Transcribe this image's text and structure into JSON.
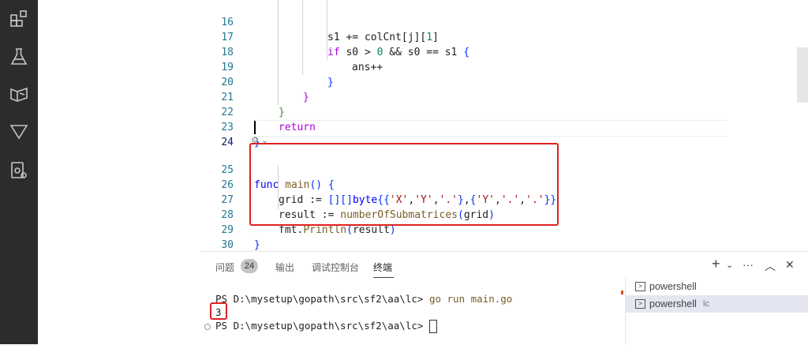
{
  "activity_bar": {
    "icons": [
      "extensions-icon",
      "flask-icon",
      "remote-icon",
      "source-control-icon",
      "run-debug-icon"
    ]
  },
  "editor": {
    "lines": [
      {
        "n": "16",
        "t": "s1 += colCnt[j][1]"
      },
      {
        "n": "17",
        "t": "if s0 > 0 && s0 == s1 {"
      },
      {
        "n": "18",
        "t": "ans++"
      },
      {
        "n": "19",
        "t": "}"
      },
      {
        "n": "20",
        "t": "}"
      },
      {
        "n": "21",
        "t": "}"
      },
      {
        "n": "22",
        "t": "return"
      },
      {
        "n": "23",
        "t": "}"
      },
      {
        "n": "24",
        "t": ""
      },
      {
        "n": "25",
        "t": "func main() {"
      },
      {
        "n": "26",
        "t": "grid := [][]byte{{'X','Y','.'},{'Y','.','.'}}"
      },
      {
        "n": "27",
        "t": "result := numberOfSubmatrices(grid)"
      },
      {
        "n": "28",
        "t": "fmt.Println(result)"
      },
      {
        "n": "29",
        "t": "}"
      },
      {
        "n": "30",
        "t": ""
      }
    ],
    "codelens": "⚙ ⌄"
  },
  "panel": {
    "tabs": {
      "problems": "问题",
      "problems_count": "24",
      "output": "输出",
      "debug_console": "调试控制台",
      "terminal": "终端"
    },
    "tools": {
      "add": "+",
      "dropdown": "⌄",
      "more": "···",
      "maximize": "︿",
      "close": "✕"
    },
    "terminal": {
      "line1_prompt": "PS D:\\mysetup\\gopath\\src\\sf2\\aa\\lc> ",
      "line1_cmd": "go run main.go",
      "output": "3",
      "line3_prompt": "PS D:\\mysetup\\gopath\\src\\sf2\\aa\\lc> "
    },
    "terminal_list": [
      {
        "label": "powershell",
        "sub": ""
      },
      {
        "label": "powershell",
        "sub": "lc"
      }
    ]
  },
  "colors": {
    "activity_bg": "#2c2c2c",
    "highlight_box": "#e02020",
    "keyword": "#0000ff",
    "control": "#af00db",
    "function": "#795e26",
    "string": "#a31515",
    "number": "#098658"
  }
}
